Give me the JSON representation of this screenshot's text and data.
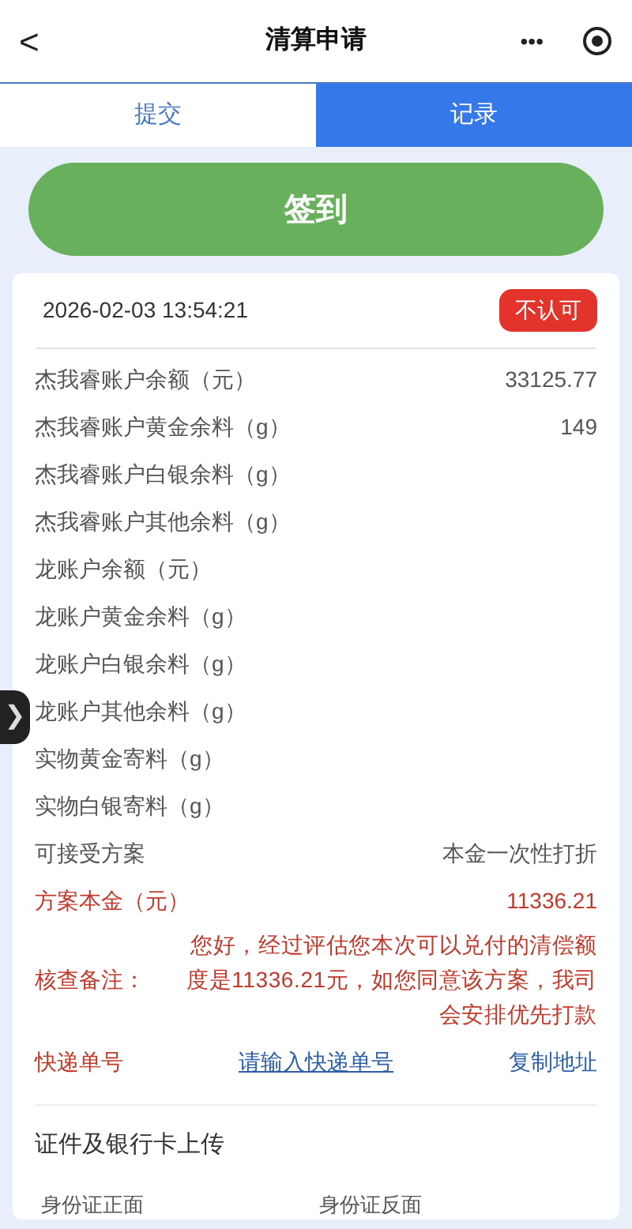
{
  "header": {
    "back": "<",
    "title": "清算申请",
    "more": "•••"
  },
  "tabs": [
    {
      "label": "提交",
      "selected": false
    },
    {
      "label": "记录",
      "selected": true
    }
  ],
  "checkin_button": "签到",
  "record": {
    "datetime": "2026-02-03 13:54:21",
    "status": "不认可",
    "fields": [
      {
        "label": "杰我睿账户余额（元）",
        "value": "33125.77",
        "kind": "plain"
      },
      {
        "label": "杰我睿账户黄金余料（g）",
        "value": "149",
        "kind": "plain"
      },
      {
        "label": "杰我睿账户白银余料（g）",
        "kind": "plain"
      },
      {
        "label": "杰我睿账户其他余料（g）",
        "kind": "plain"
      },
      {
        "label": "龙账户余额（元）",
        "kind": "plain"
      },
      {
        "label": "龙账户黄金余料（g）",
        "kind": "plain"
      },
      {
        "label": "龙账户白银余料（g）",
        "kind": "plain"
      },
      {
        "label": "龙账户其他余料（g）",
        "kind": "plain"
      },
      {
        "label": "实物黄金寄料（g）",
        "kind": "plain"
      },
      {
        "label": "实物白银寄料（g）",
        "kind": "plain"
      },
      {
        "label": "可接受方案",
        "value": "本金一次性打折",
        "kind": "plain"
      },
      {
        "label": "方案本金（元）",
        "value": "11336.21",
        "kind": "alert"
      }
    ],
    "remark": {
      "label": "核查备注：",
      "text": "您好，经过评估您本次可以兑付的清偿额度是11336.21元，如您同意该方案，我司会安排优先打款"
    },
    "express": {
      "label": "快递单号",
      "link": "请输入快递单号",
      "copy": "复制地址"
    },
    "upload": {
      "title": "证件及银行卡上传",
      "items": [
        "身份证正面",
        "身份证反面"
      ]
    }
  },
  "side_handle": "❯"
}
